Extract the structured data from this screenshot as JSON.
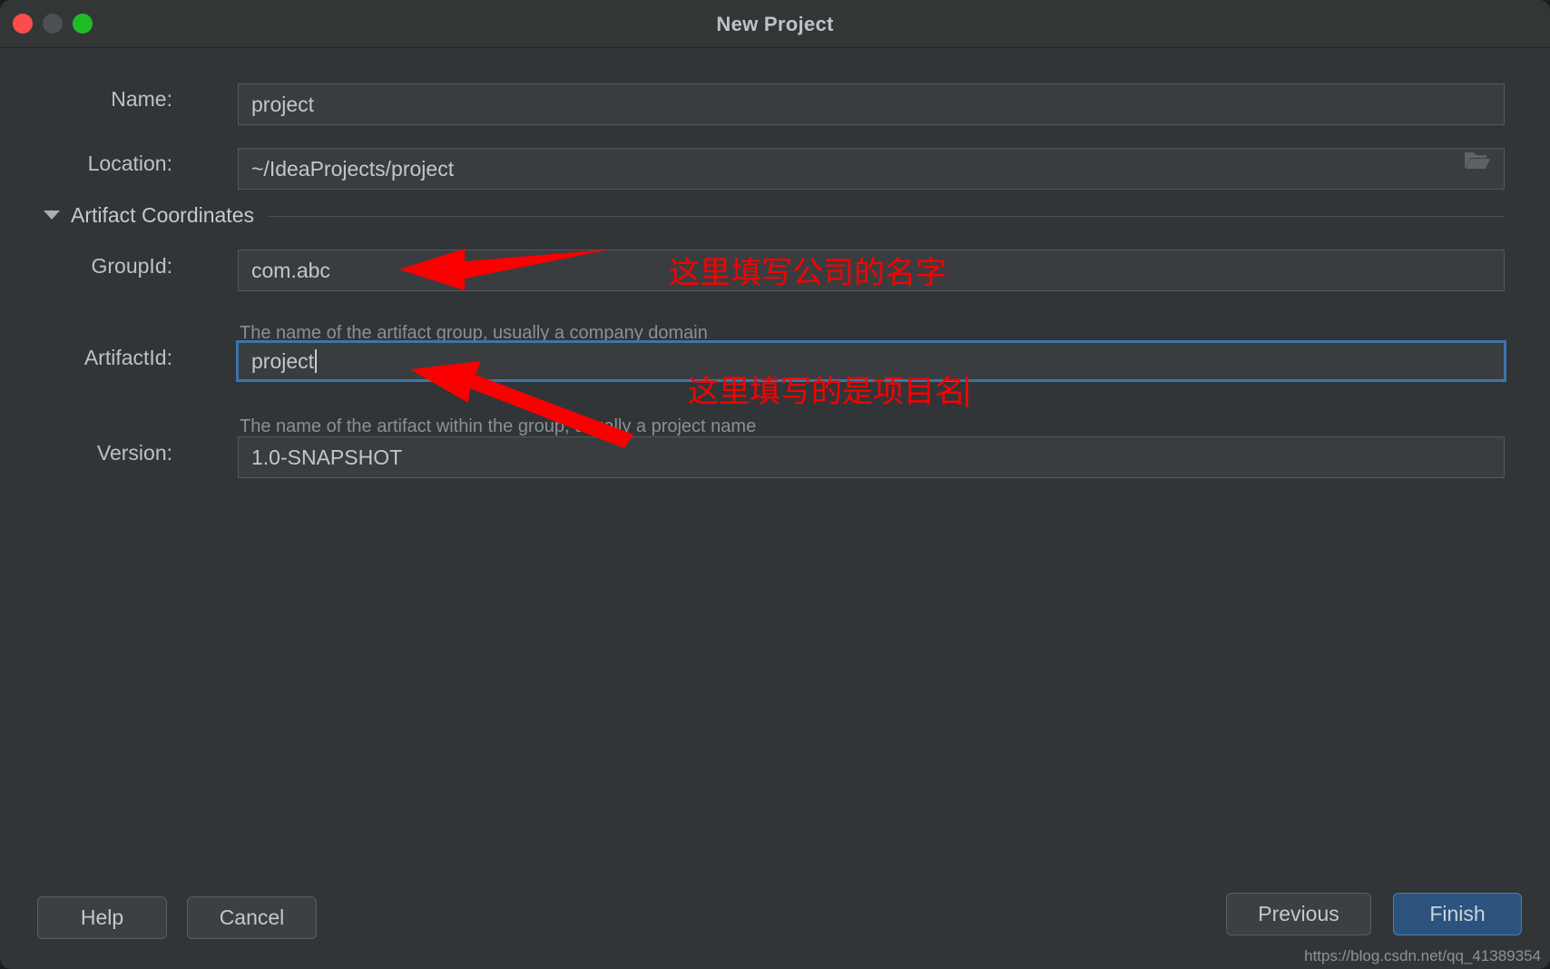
{
  "window": {
    "title": "New Project",
    "controls": [
      {
        "name": "close",
        "color": "#fc4c4c"
      },
      {
        "name": "minimize",
        "color": "#4d5052"
      },
      {
        "name": "maximize",
        "color": "#1ebd28"
      }
    ]
  },
  "form": {
    "name": {
      "label": "Name:",
      "value": "project"
    },
    "location": {
      "label": "Location:",
      "value": "~/IdeaProjects/project",
      "browse_icon": "folder-open-icon"
    },
    "section": {
      "label": "Artifact Coordinates",
      "expanded": true,
      "caret_icon": "triangle-down-icon"
    },
    "group_id": {
      "label": "GroupId:",
      "value": "com.abc",
      "hint": "The name of the artifact group, usually a company domain",
      "focused": false
    },
    "artifact_id": {
      "label": "ArtifactId:",
      "value": "project",
      "hint": "The name of the artifact within the group, usually a project name",
      "focused": true
    },
    "version": {
      "label": "Version:",
      "value": "1.0-SNAPSHOT"
    }
  },
  "annotations": {
    "accent_color": "#fb0000",
    "group_id_note": "这里填写公司的名字",
    "artifact_id_note": "这里填写的是项目名"
  },
  "footer": {
    "help_label": "Help",
    "cancel_label": "Cancel",
    "previous_label": "Previous",
    "finish_label": "Finish",
    "finish_color": "#2b537e"
  },
  "watermark": "https://blog.csdn.net/qq_41389354"
}
